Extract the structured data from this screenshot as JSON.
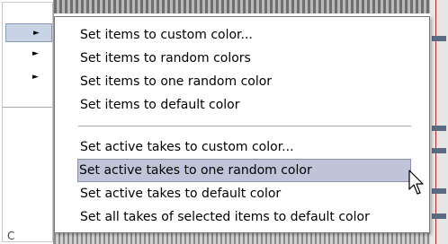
{
  "submenu": {
    "group1": [
      {
        "label": "Set items to custom color..."
      },
      {
        "label": "Set items to random colors"
      },
      {
        "label": "Set items to one random color"
      },
      {
        "label": "Set items to default color"
      }
    ],
    "group2": [
      {
        "label": "Set active takes to custom color..."
      },
      {
        "label": "Set active takes to one random color",
        "highlighted": true
      },
      {
        "label": "Set active takes to default color"
      },
      {
        "label": "Set all takes of selected items to default color"
      }
    ]
  },
  "parent_menu": {
    "arrow_glyph": "►",
    "corner_char": "C"
  },
  "colors": {
    "highlight": "#bfc4d9",
    "highlight_border": "#8c92a8"
  },
  "cursor_icon": "arrow-pointer-icon"
}
